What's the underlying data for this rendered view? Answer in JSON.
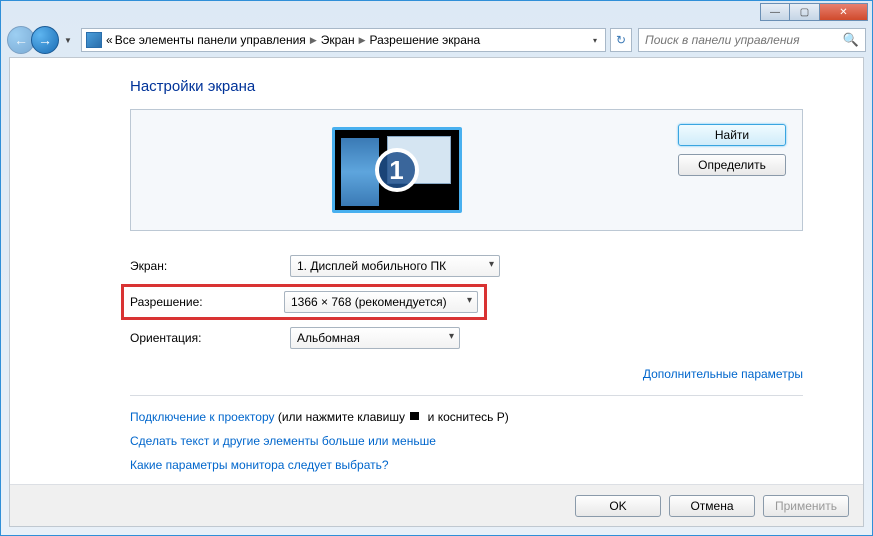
{
  "window_controls": {
    "minimize": "—",
    "maximize": "▢",
    "close": "✕"
  },
  "breadcrumb": {
    "prefix": "«",
    "item1": "Все элементы панели управления",
    "item2": "Экран",
    "item3": "Разрешение экрана"
  },
  "search": {
    "placeholder": "Поиск в панели управления"
  },
  "page": {
    "title": "Настройки экрана"
  },
  "monitor": {
    "number": "1"
  },
  "panel_buttons": {
    "find": "Найти",
    "identify": "Определить"
  },
  "form": {
    "display_label": "Экран:",
    "display_value": "1. Дисплей мобильного ПК",
    "resolution_label": "Разрешение:",
    "resolution_value": "1366 × 768 (рекомендуется)",
    "orientation_label": "Ориентация:",
    "orientation_value": "Альбомная"
  },
  "links": {
    "advanced": "Дополнительные параметры",
    "projector_link": "Подключение к проектору",
    "projector_suffix_a": " (или нажмите клавишу ",
    "projector_suffix_b": " и коснитесь P)",
    "textsize": "Сделать текст и другие элементы больше или меньше",
    "which_monitor": "Какие параметры монитора следует выбрать?"
  },
  "buttons": {
    "ok": "OK",
    "cancel": "Отмена",
    "apply": "Применить"
  }
}
